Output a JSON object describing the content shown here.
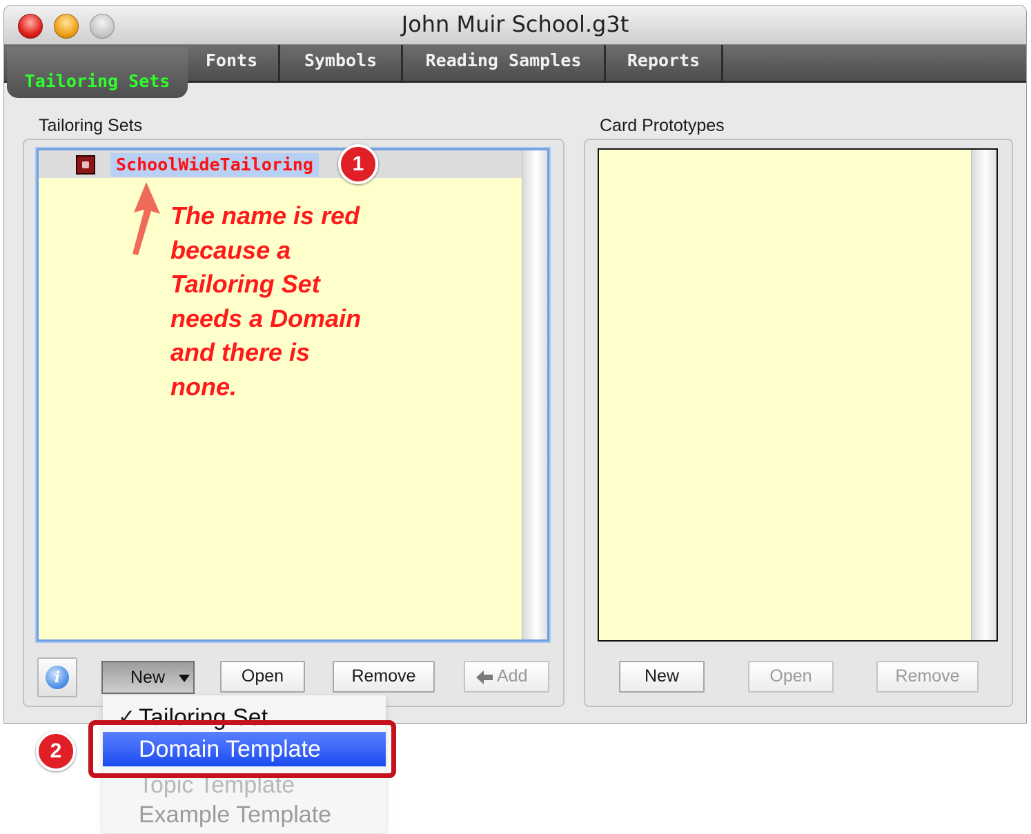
{
  "window": {
    "title": "John Muir School.g3t"
  },
  "tabs": {
    "active": "Tailoring Sets",
    "items": [
      "Fonts",
      "Symbols",
      "Reading Samples",
      "Reports"
    ]
  },
  "tailoring_sets": {
    "label": "Tailoring Sets",
    "items": [
      {
        "name": "SchoolWideTailoring",
        "status_color": "#ff1010"
      }
    ],
    "buttons": {
      "new": "New",
      "open": "Open",
      "remove": "Remove",
      "add": "Add"
    }
  },
  "card_prototypes": {
    "label": "Card Prototypes",
    "buttons": {
      "new": "New",
      "open": "Open",
      "remove": "Remove"
    }
  },
  "annotations": {
    "badge_1": "1",
    "badge_2": "2",
    "note_lines": [
      "The name is red",
      "because a",
      "Tailoring Set",
      "needs a Domain",
      "and there is",
      "none."
    ]
  },
  "new_menu": {
    "items": [
      "Tailoring Set",
      "Domain Template",
      "Topic Template",
      "Example Template"
    ],
    "checked": "Tailoring Set",
    "highlighted": "Domain Template"
  },
  "colors": {
    "list_background": "#ffffcc",
    "active_tab_text": "#2dff2d",
    "annotation_red": "#e01f26",
    "menu_highlight": "#1c4bf0"
  }
}
